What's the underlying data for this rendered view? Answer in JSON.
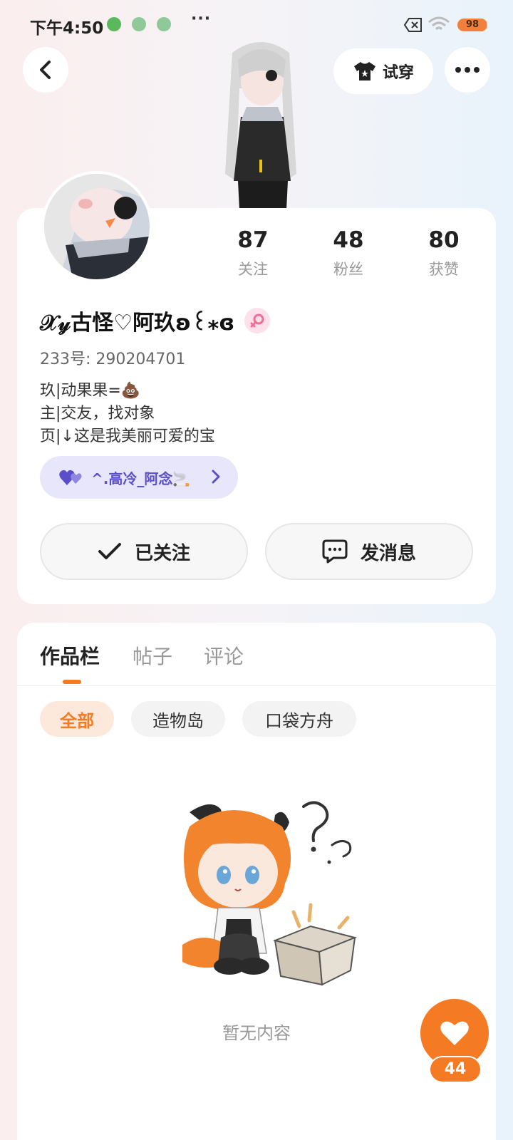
{
  "status_bar": {
    "time": "下午4:50",
    "more": "···",
    "battery_level": 98,
    "battery_text": "98",
    "icons": [
      "app-notification-icon",
      "app-notification-icon",
      "app-notification-icon",
      "close-box-icon",
      "wifi-icon",
      "battery-icon"
    ]
  },
  "header": {
    "back_icon": "chevron-left-icon",
    "try_on_icon": "tshirt-icon",
    "try_on_label": "试穿",
    "more_icon": "more-horizontal-icon"
  },
  "profile": {
    "stats": [
      {
        "value": "87",
        "label": "关注"
      },
      {
        "value": "48",
        "label": "粉丝"
      },
      {
        "value": "80",
        "label": "获赞"
      }
    ],
    "username": "𝒳𝓎古怪♡阿玖ʚ꒰⁎ɞ",
    "gender_icon": "female-icon",
    "uid": "233号: 290204701",
    "bio": [
      "玖|动果果=💩",
      "主|交友，找对象",
      "页|↓这是我美丽可爱的宝"
    ],
    "link_chip": {
      "icon": "hearts-icon",
      "text": "^.高冷_阿念🚬"
    },
    "follow_button": {
      "icon": "check-icon",
      "label": "已关注"
    },
    "message_button": {
      "icon": "message-icon",
      "label": "发消息"
    }
  },
  "content": {
    "tabs": [
      {
        "label": "作品栏",
        "active": true
      },
      {
        "label": "帖子",
        "active": false
      },
      {
        "label": "评论",
        "active": false
      }
    ],
    "filters": [
      {
        "label": "全部",
        "active": true
      },
      {
        "label": "造物岛",
        "active": false
      },
      {
        "label": "口袋方舟",
        "active": false
      }
    ],
    "empty_text": "暂无内容"
  },
  "like_fab": {
    "icon": "heart-icon",
    "count": "44"
  },
  "colors": {
    "accent": "#f57a24",
    "link_bg": "#e8e6fb",
    "link_text": "#5a4fc8",
    "female": "#f06d97"
  }
}
